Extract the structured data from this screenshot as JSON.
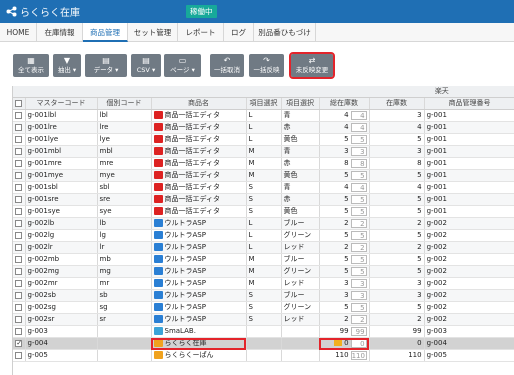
{
  "app": {
    "title": "らくらく在庫",
    "status": "稼働中"
  },
  "nav": [
    "HOME",
    "在庫情報",
    "商品管理",
    "セット管理",
    "レポート",
    "ログ",
    "別品番ひもづけ"
  ],
  "toolbar": {
    "show_all": "全て表示",
    "extract": "抽出",
    "data": "データ",
    "csv": "CSV",
    "page": "ページ",
    "cancel_all": "一括取消",
    "apply_all": "一括反映",
    "unreflected": "未反映変更"
  },
  "table": {
    "group_header": "楽天",
    "headers": [
      "マスターコード",
      "個別コード",
      "商品名",
      "項目選択",
      "項目選択",
      "総在庫数",
      "在庫数",
      "商品管理番号"
    ],
    "rows": [
      {
        "master": "g-001lbl",
        "code": "lbl",
        "name": "商品一括エディタ",
        "opt1": "L",
        "opt2": "青",
        "total": "4",
        "box": "4",
        "stock": "3",
        "mgmt": "g-001",
        "icon": "red"
      },
      {
        "master": "g-001lre",
        "code": "lre",
        "name": "商品一括エディタ",
        "opt1": "L",
        "opt2": "赤",
        "total": "4",
        "box": "4",
        "stock": "4",
        "mgmt": "g-001",
        "icon": "red"
      },
      {
        "master": "g-001lye",
        "code": "lye",
        "name": "商品一括エディタ",
        "opt1": "L",
        "opt2": "黄色",
        "total": "5",
        "box": "5",
        "stock": "5",
        "mgmt": "g-001",
        "icon": "red"
      },
      {
        "master": "g-001mbl",
        "code": "mbl",
        "name": "商品一括エディタ",
        "opt1": "M",
        "opt2": "青",
        "total": "3",
        "box": "3",
        "stock": "3",
        "mgmt": "g-001",
        "icon": "red"
      },
      {
        "master": "g-001mre",
        "code": "mre",
        "name": "商品一括エディタ",
        "opt1": "M",
        "opt2": "赤",
        "total": "8",
        "box": "8",
        "stock": "8",
        "mgmt": "g-001",
        "icon": "red"
      },
      {
        "master": "g-001mye",
        "code": "mye",
        "name": "商品一括エディタ",
        "opt1": "M",
        "opt2": "黄色",
        "total": "5",
        "box": "5",
        "stock": "5",
        "mgmt": "g-001",
        "icon": "red"
      },
      {
        "master": "g-001sbl",
        "code": "sbl",
        "name": "商品一括エディタ",
        "opt1": "S",
        "opt2": "青",
        "total": "4",
        "box": "4",
        "stock": "4",
        "mgmt": "g-001",
        "icon": "red"
      },
      {
        "master": "g-001sre",
        "code": "sre",
        "name": "商品一括エディタ",
        "opt1": "S",
        "opt2": "赤",
        "total": "5",
        "box": "5",
        "stock": "5",
        "mgmt": "g-001",
        "icon": "red"
      },
      {
        "master": "g-001sye",
        "code": "sye",
        "name": "商品一括エディタ",
        "opt1": "S",
        "opt2": "黄色",
        "total": "5",
        "box": "5",
        "stock": "5",
        "mgmt": "g-001",
        "icon": "red"
      },
      {
        "master": "g-002lb",
        "code": "lb",
        "name": "ウルトラASP",
        "opt1": "L",
        "opt2": "ブルー",
        "total": "2",
        "box": "2",
        "stock": "2",
        "mgmt": "g-002",
        "icon": "blue"
      },
      {
        "master": "g-002lg",
        "code": "lg",
        "name": "ウルトラASP",
        "opt1": "L",
        "opt2": "グリーン",
        "total": "5",
        "box": "5",
        "stock": "5",
        "mgmt": "g-002",
        "icon": "blue"
      },
      {
        "master": "g-002lr",
        "code": "lr",
        "name": "ウルトラASP",
        "opt1": "L",
        "opt2": "レッド",
        "total": "2",
        "box": "2",
        "stock": "2",
        "mgmt": "g-002",
        "icon": "blue"
      },
      {
        "master": "g-002mb",
        "code": "mb",
        "name": "ウルトラASP",
        "opt1": "M",
        "opt2": "ブルー",
        "total": "5",
        "box": "5",
        "stock": "5",
        "mgmt": "g-002",
        "icon": "blue"
      },
      {
        "master": "g-002mg",
        "code": "mg",
        "name": "ウルトラASP",
        "opt1": "M",
        "opt2": "グリーン",
        "total": "5",
        "box": "5",
        "stock": "5",
        "mgmt": "g-002",
        "icon": "blue"
      },
      {
        "master": "g-002mr",
        "code": "mr",
        "name": "ウルトラASP",
        "opt1": "M",
        "opt2": "レッド",
        "total": "3",
        "box": "3",
        "stock": "3",
        "mgmt": "g-002",
        "icon": "blue"
      },
      {
        "master": "g-002sb",
        "code": "sb",
        "name": "ウルトラASP",
        "opt1": "S",
        "opt2": "ブルー",
        "total": "3",
        "box": "3",
        "stock": "3",
        "mgmt": "g-002",
        "icon": "blue"
      },
      {
        "master": "g-002sg",
        "code": "sg",
        "name": "ウルトラASP",
        "opt1": "S",
        "opt2": "グリーン",
        "total": "5",
        "box": "5",
        "stock": "5",
        "mgmt": "g-002",
        "icon": "blue"
      },
      {
        "master": "g-002sr",
        "code": "sr",
        "name": "ウルトラASP",
        "opt1": "S",
        "opt2": "レッド",
        "total": "2",
        "box": "2",
        "stock": "2",
        "mgmt": "g-002",
        "icon": "blue"
      },
      {
        "master": "g-003",
        "code": "",
        "name": "SmaLAB.",
        "opt1": "",
        "opt2": "",
        "total": "99",
        "box": "99",
        "stock": "99",
        "mgmt": "g-003",
        "icon": "teal"
      },
      {
        "master": "g-004",
        "code": "",
        "name": "らくらく在庫",
        "opt1": "",
        "opt2": "",
        "total": "0",
        "box": "0",
        "stock": "0",
        "mgmt": "g-004",
        "icon": "orange",
        "selected": true
      },
      {
        "master": "g-005",
        "code": "",
        "name": "らくらくーぱん",
        "opt1": "",
        "opt2": "",
        "total": "110",
        "box": "110",
        "stock": "110",
        "mgmt": "g-005",
        "icon": "orange"
      }
    ]
  },
  "colors": {
    "header": "#1f6fb4",
    "status": "#17a99a",
    "highlight": "#e3242b",
    "button": "#707a84"
  },
  "icons": {
    "logo": "share-network-icon",
    "show_all": "grid-icon",
    "extract": "funnel-icon",
    "data": "document-icon",
    "csv": "document-icon",
    "page": "page-icon",
    "cancel_all": "undo-icon",
    "apply_all": "redo-icon",
    "unreflected": "swap-icon"
  }
}
